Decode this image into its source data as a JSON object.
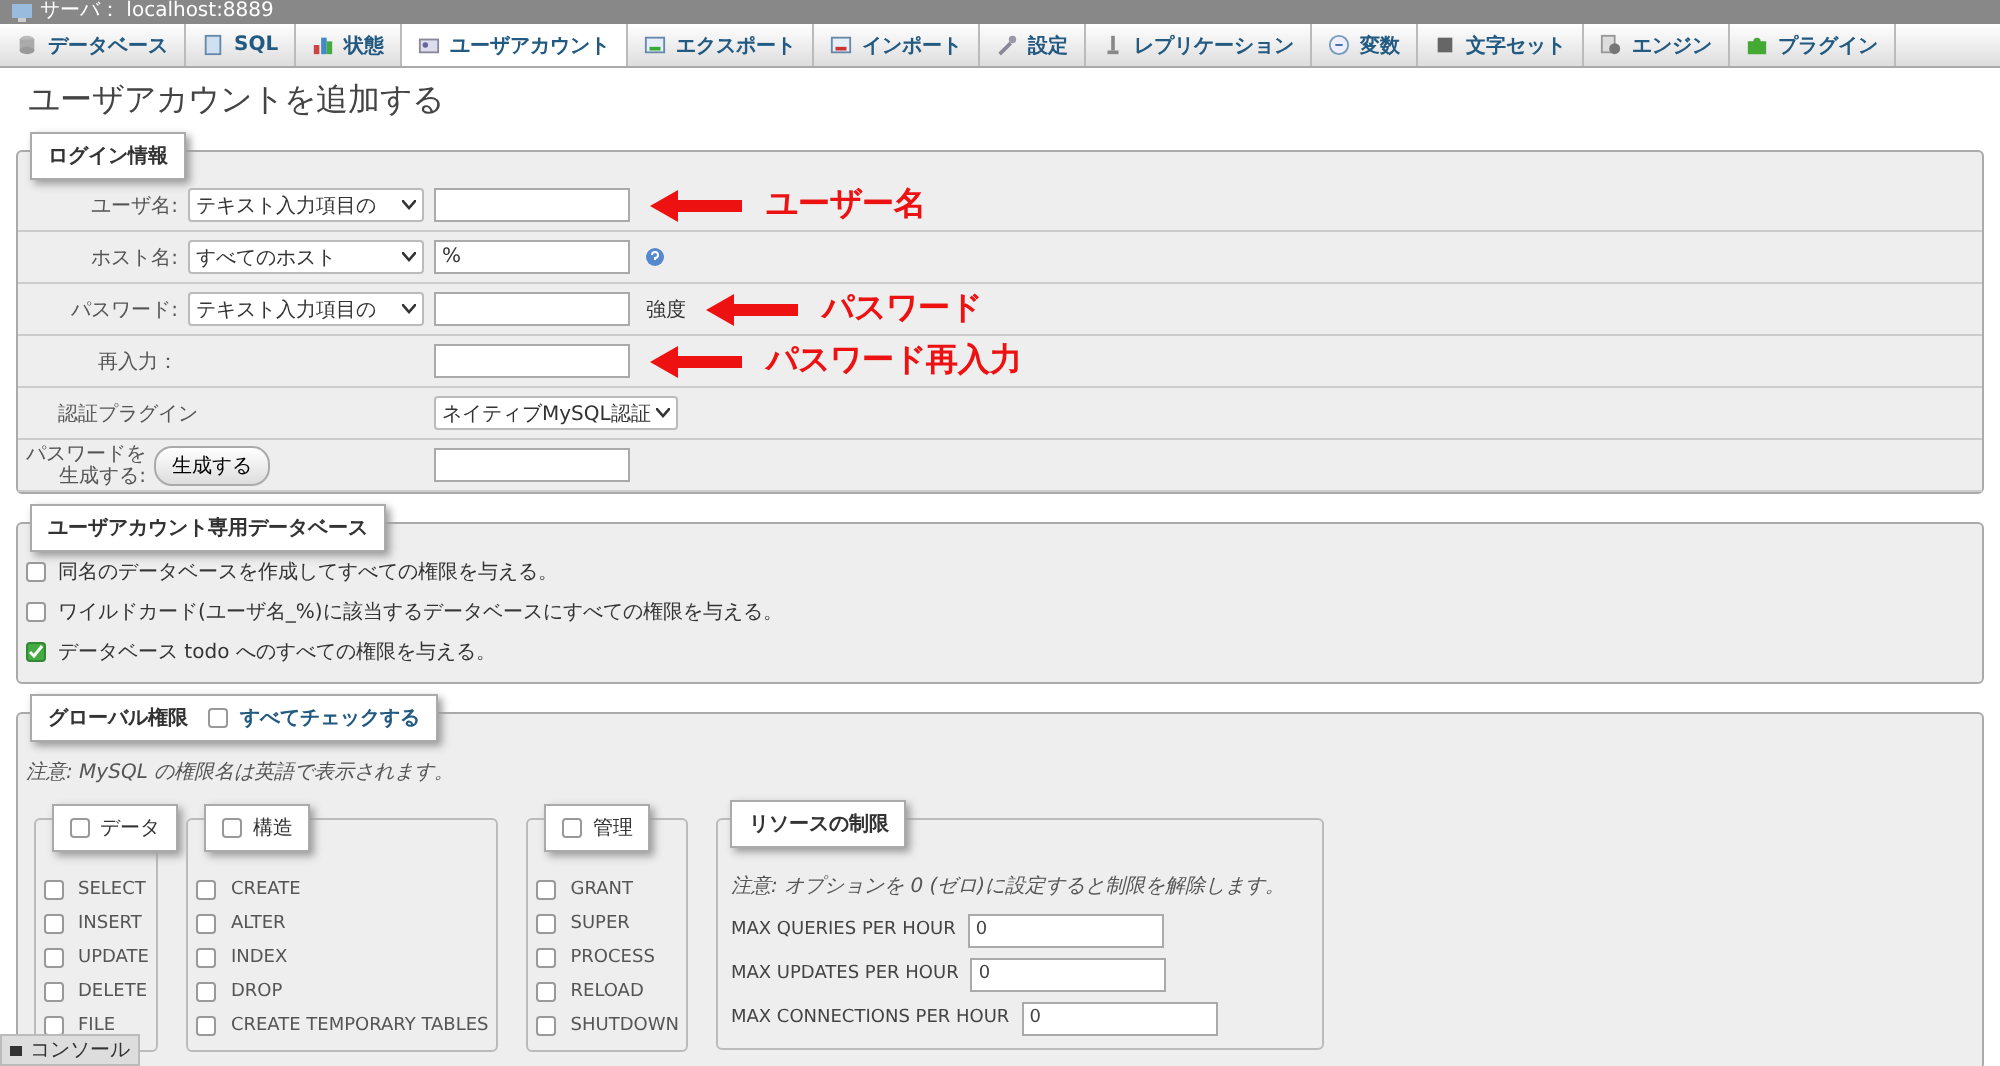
{
  "window": {
    "title": "サーバ： localhost:8889"
  },
  "tabs": [
    {
      "label": "データベース",
      "selected": false
    },
    {
      "label": "SQL",
      "selected": false
    },
    {
      "label": "状態",
      "selected": false
    },
    {
      "label": "ユーザアカウント",
      "selected": true
    },
    {
      "label": "エクスポート",
      "selected": false
    },
    {
      "label": "インポート",
      "selected": false
    },
    {
      "label": "設定",
      "selected": false
    },
    {
      "label": "レプリケーション",
      "selected": false
    },
    {
      "label": "変数",
      "selected": false
    },
    {
      "label": "文字セット",
      "selected": false
    },
    {
      "label": "エンジン",
      "selected": false
    },
    {
      "label": "プラグイン",
      "selected": false
    }
  ],
  "page_title": "ユーザアカウントを追加する",
  "login": {
    "legend": "ログイン情報",
    "rows": [
      {
        "kind": "select-field",
        "label": "ユーザ名:",
        "select": "テキスト入力項目の",
        "annotation": "ユーザー名"
      },
      {
        "kind": "select-field",
        "label": "ホスト名:",
        "select": "すべてのホスト",
        "value": "%",
        "help": true
      },
      {
        "kind": "select-field",
        "label": "パスワード:",
        "select": "テキスト入力項目の",
        "note": "強度",
        "annotation": "パスワード"
      },
      {
        "kind": "field",
        "label": "再入力：",
        "annotation": "パスワード再入力"
      },
      {
        "kind": "select",
        "label": "認証プラグイン",
        "select": "ネイティブMySQL認証"
      },
      {
        "kind": "button-field",
        "label": "パスワードを生成する:",
        "button": "生成する"
      }
    ]
  },
  "dedicated": {
    "legend": "ユーザアカウント専用データベース",
    "options": [
      {
        "label": "同名のデータベースを作成してすべての権限を与える。",
        "checked": false
      },
      {
        "label": "ワイルドカード(ユーザ名_%)に該当するデータベースにすべての権限を与える。",
        "checked": false
      },
      {
        "label": "データベース todo へのすべての権限を与える。",
        "checked": true
      }
    ]
  },
  "global": {
    "legend": "グローバル権限",
    "check_all": {
      "label": "すべてチェックする",
      "checked": false
    },
    "note": "注意: MySQL の権限名は英語で表示されます。",
    "groups": [
      {
        "legend": "データ",
        "checked": false,
        "items": [
          {
            "label": "SELECT",
            "checked": false
          },
          {
            "label": "INSERT",
            "checked": false
          },
          {
            "label": "UPDATE",
            "checked": false
          },
          {
            "label": "DELETE",
            "checked": false
          },
          {
            "label": "FILE",
            "checked": false
          }
        ]
      },
      {
        "legend": "構造",
        "checked": false,
        "items": [
          {
            "label": "CREATE",
            "checked": false
          },
          {
            "label": "ALTER",
            "checked": false
          },
          {
            "label": "INDEX",
            "checked": false
          },
          {
            "label": "DROP",
            "checked": false
          },
          {
            "label": "CREATE TEMPORARY TABLES",
            "checked": false
          }
        ]
      },
      {
        "legend": "管理",
        "checked": false,
        "items": [
          {
            "label": "GRANT",
            "checked": false
          },
          {
            "label": "SUPER",
            "checked": false
          },
          {
            "label": "PROCESS",
            "checked": false
          },
          {
            "label": "RELOAD",
            "checked": false
          },
          {
            "label": "SHUTDOWN",
            "checked": false
          }
        ]
      }
    ],
    "resources": {
      "legend": "リソースの制限",
      "note": "注意: オプションを 0 (ゼロ)に設定すると制限を解除します。",
      "limits": [
        {
          "label": "MAX QUERIES PER HOUR",
          "value": "0"
        },
        {
          "label": "MAX UPDATES PER HOUR",
          "value": "0"
        },
        {
          "label": "MAX CONNECTIONS PER HOUR",
          "value": "0"
        }
      ]
    }
  },
  "console": {
    "label": "コンソール"
  }
}
